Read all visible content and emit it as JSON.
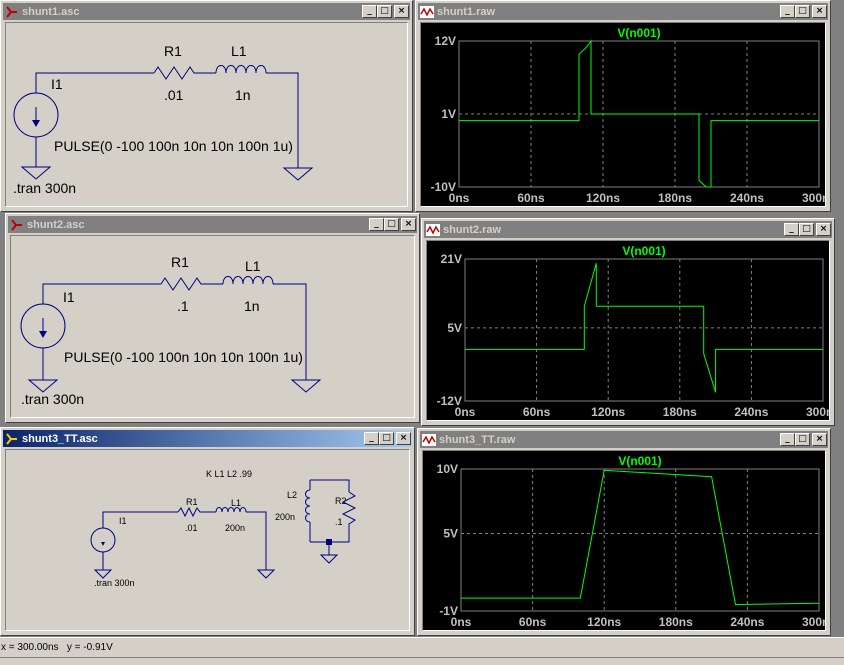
{
  "windows": [
    {
      "id": "shunt1-asc",
      "kind": "schematic",
      "title": "shunt1.asc",
      "active": false,
      "schematic": {
        "r_name": "R1",
        "r_value": ".01",
        "l_name": "L1",
        "l_value": "1n",
        "source_name": "I1",
        "source_value": "PULSE(0 -100 100n 10n 10n 100n 1u)",
        "directive": ".tran 300n"
      }
    },
    {
      "id": "shunt1-raw",
      "kind": "waveform",
      "title": "shunt1.raw",
      "active": false,
      "trace_label": "V(n001)",
      "chart_data": {
        "type": "line",
        "title": "V(n001)",
        "x_unit": "ns",
        "y_unit": "V",
        "xlim": [
          0,
          300
        ],
        "ylim": [
          -10,
          12
        ],
        "x_ticks": [
          0,
          60,
          120,
          180,
          240,
          300
        ],
        "x_tick_labels": [
          "0ns",
          "60ns",
          "120ns",
          "180ns",
          "240ns",
          "300ns"
        ],
        "y_ticks": [
          12,
          1,
          -10
        ],
        "y_tick_labels": [
          "12V",
          "1V",
          "-10V"
        ],
        "grid": true,
        "series": [
          {
            "color": "#00ff00",
            "x": [
              0,
              100,
              100,
              106,
              110,
              110,
              200,
              200,
              206,
              210,
              210,
              300
            ],
            "y": [
              0,
              0,
              10,
              11,
              12,
              1,
              1,
              -9,
              -10,
              -10,
              0,
              0
            ]
          }
        ]
      }
    },
    {
      "id": "shunt2-asc",
      "kind": "schematic",
      "title": "shunt2.asc",
      "active": false,
      "schematic": {
        "r_name": "R1",
        "r_value": ".1",
        "l_name": "L1",
        "l_value": "1n",
        "source_name": "I1",
        "source_value": "PULSE(0 -100 100n 10n 10n 100n 1u)",
        "directive": ".tran 300n"
      }
    },
    {
      "id": "shunt2-raw",
      "kind": "waveform",
      "title": "shunt2.raw",
      "active": false,
      "trace_label": "V(n001)",
      "chart_data": {
        "type": "line",
        "title": "V(n001)",
        "x_unit": "ns",
        "y_unit": "V",
        "xlim": [
          0,
          300
        ],
        "ylim": [
          -12,
          21
        ],
        "x_ticks": [
          0,
          60,
          120,
          180,
          240,
          300
        ],
        "x_tick_labels": [
          "0ns",
          "60ns",
          "120ns",
          "180ns",
          "240ns",
          "300ns"
        ],
        "y_ticks": [
          21,
          5,
          -12
        ],
        "y_tick_labels": [
          "21V",
          "5V",
          "-12V"
        ],
        "grid": true,
        "series": [
          {
            "color": "#00ff00",
            "x": [
              0,
              100,
              100,
              110,
              110,
              200,
              200,
              210,
              210,
              300
            ],
            "y": [
              0,
              0,
              10,
              20,
              10,
              10,
              -1,
              -10,
              0,
              0
            ]
          }
        ]
      }
    },
    {
      "id": "shunt3-asc",
      "kind": "schematic3",
      "title": "shunt3_TT.asc",
      "active": true,
      "schematic": {
        "coupling": "K L1 L2 .99",
        "source_name": "I1",
        "r1_name": "R1",
        "r1_value": ".01",
        "l1_name": "L1",
        "l1_value": "200n",
        "l2_name": "L2",
        "l2_value": "200n",
        "r2_name": "R2",
        "r2_value": ".1",
        "directive": ".tran 300n"
      }
    },
    {
      "id": "shunt3-raw",
      "kind": "waveform",
      "title": "shunt3_TT.raw",
      "active": false,
      "trace_label": "V(n001)",
      "chart_data": {
        "type": "line",
        "title": "V(n001)",
        "x_unit": "ns",
        "y_unit": "V",
        "xlim": [
          0,
          300
        ],
        "ylim": [
          -1,
          10
        ],
        "x_ticks": [
          0,
          60,
          120,
          180,
          240,
          300
        ],
        "x_tick_labels": [
          "0ns",
          "60ns",
          "120ns",
          "180ns",
          "240ns",
          "300ns"
        ],
        "y_ticks": [
          10,
          5,
          -1
        ],
        "y_tick_labels": [
          "10V",
          "5V",
          "-1V"
        ],
        "grid": true,
        "series": [
          {
            "color": "#00ff00",
            "x": [
              0,
              100,
              120,
              210,
              230,
              300
            ],
            "y": [
              0,
              0,
              9.9,
              9.4,
              -0.5,
              -0.4
            ]
          }
        ]
      }
    }
  ],
  "status": {
    "x": "x = 300.00ns",
    "y": "y = -0.91V"
  }
}
